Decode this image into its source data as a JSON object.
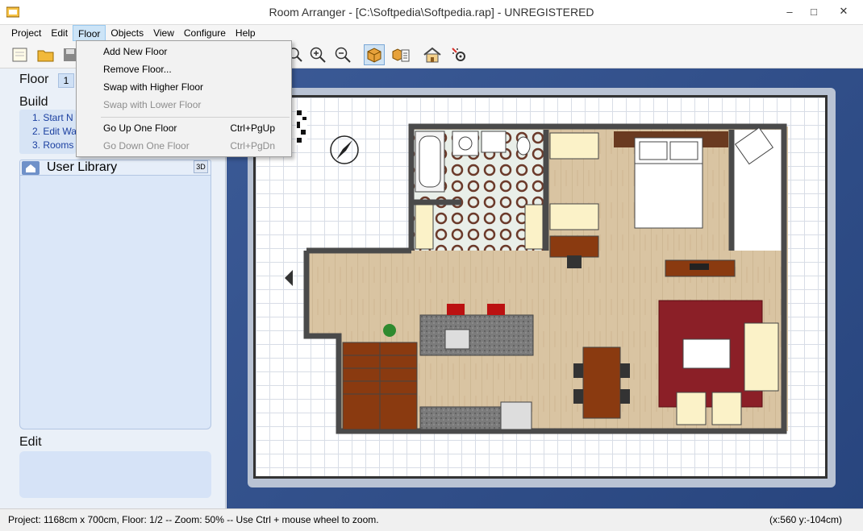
{
  "window": {
    "title": "Room Arranger - [C:\\Softpedia\\Softpedia.rap] - UNREGISTERED",
    "controls": [
      "–",
      "□",
      "✕"
    ]
  },
  "menu": [
    "Project",
    "Edit",
    "Floor",
    "Objects",
    "View",
    "Configure",
    "Help"
  ],
  "floor_menu": {
    "items": [
      {
        "label": "Add New Floor",
        "shortcut": "",
        "enabled": true
      },
      {
        "label": "Remove Floor...",
        "shortcut": "",
        "enabled": true
      },
      {
        "label": "Swap with Higher Floor",
        "shortcut": "",
        "enabled": true
      },
      {
        "label": "Swap with Lower Floor",
        "shortcut": "",
        "enabled": false
      },
      {
        "label": "Go Up One Floor",
        "shortcut": "Ctrl+PgUp",
        "enabled": true
      },
      {
        "label": "Go Down One Floor",
        "shortcut": "Ctrl+PgDn",
        "enabled": false
      }
    ]
  },
  "left_panel": {
    "floor_label": "Floor",
    "floor_number": "1",
    "build_label": "Build",
    "build_items": [
      "1. Start N",
      "2. Edit Wa",
      "3. Rooms"
    ],
    "user_library_label": "User Library",
    "three_d_label": "3D",
    "edit_label": "Edit"
  },
  "status": {
    "left": "Project: 1168cm x 700cm, Floor: 1/2 -- Zoom: 50% -- Use Ctrl + mouse wheel to zoom.",
    "right": "(x:560 y:-104cm)"
  },
  "colors": {
    "accent": "#1a3fa0",
    "canvas_bg": "#2f4d88",
    "wall": "#4a4a4a",
    "wood_floor": "#d7c3a4",
    "rug": "#8b1f27"
  }
}
